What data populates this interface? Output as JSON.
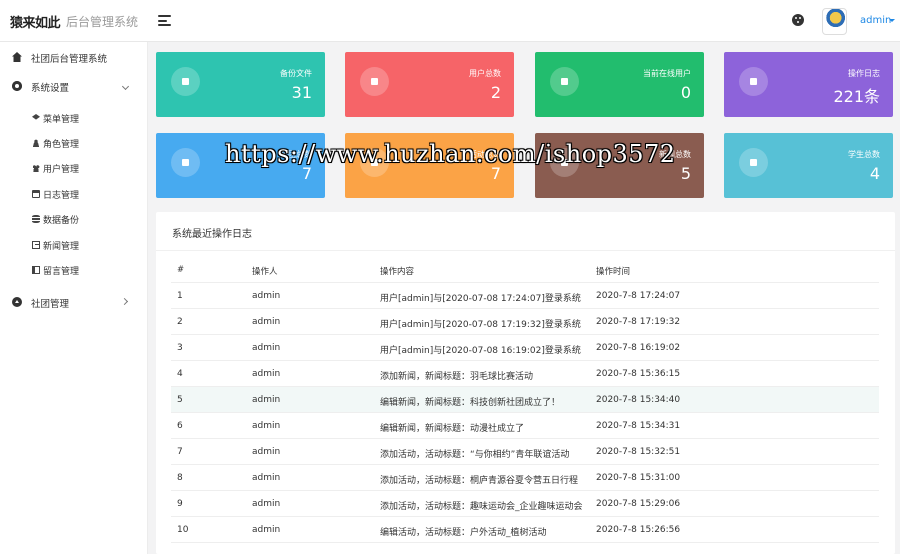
{
  "brand": {
    "logo": "猿来如此",
    "title": "后台管理系统"
  },
  "header": {
    "user": "admin"
  },
  "sidebar": {
    "items": [
      {
        "label": "社团后台管理系统"
      },
      {
        "label": "系统设置"
      },
      {
        "label": "菜单管理"
      },
      {
        "label": "角色管理"
      },
      {
        "label": "用户管理"
      },
      {
        "label": "日志管理"
      },
      {
        "label": "数据备份"
      },
      {
        "label": "新闻管理"
      },
      {
        "label": "留言管理"
      },
      {
        "label": "社团管理"
      }
    ]
  },
  "cards": [
    {
      "title": "备份文件",
      "value": "31",
      "color": "#2ec4b0"
    },
    {
      "title": "用户总数",
      "value": "2",
      "color": "#f66468"
    },
    {
      "title": "当前在线用户",
      "value": "0",
      "color": "#22bd6e"
    },
    {
      "title": "操作日志",
      "value": "221条",
      "color": "#8d63da"
    },
    {
      "title": "社团总数",
      "value": "7",
      "color": "#47aaf0"
    },
    {
      "title": "活动总数",
      "value": "7",
      "color": "#fba346"
    },
    {
      "title": "新闻总数",
      "value": "5",
      "color": "#8a5c50"
    },
    {
      "title": "学生总数",
      "value": "4",
      "color": "#57c1d6"
    }
  ],
  "watermark": "https://www.huzhan.com/ishop3572",
  "log_panel": {
    "title": "系统最近操作日志",
    "columns": [
      "#",
      "操作人",
      "操作内容",
      "操作时间"
    ],
    "rows": [
      [
        "1",
        "admin",
        "用户[admin]与[2020-07-08 17:24:07]登录系统",
        "2020-7-8 17:24:07"
      ],
      [
        "2",
        "admin",
        "用户[admin]与[2020-07-08 17:19:32]登录系统",
        "2020-7-8 17:19:32"
      ],
      [
        "3",
        "admin",
        "用户[admin]与[2020-07-08 16:19:02]登录系统",
        "2020-7-8 16:19:02"
      ],
      [
        "4",
        "admin",
        "添加新闻，新闻标题：羽毛球比赛活动",
        "2020-7-8 15:36:15"
      ],
      [
        "5",
        "admin",
        "编辑新闻，新闻标题：科技创新社团成立了！",
        "2020-7-8 15:34:40"
      ],
      [
        "6",
        "admin",
        "编辑新闻，新闻标题：动漫社成立了",
        "2020-7-8 15:34:31"
      ],
      [
        "7",
        "admin",
        "添加活动，活动标题：“与你相约”青年联谊活动",
        "2020-7-8 15:32:51"
      ],
      [
        "8",
        "admin",
        "添加活动，活动标题：桐庐青源谷夏令营五日行程",
        "2020-7-8 15:31:00"
      ],
      [
        "9",
        "admin",
        "添加活动，活动标题：趣味运动会_企业趣味运动会",
        "2020-7-8 15:29:06"
      ],
      [
        "10",
        "admin",
        "编辑活动，活动标题：户外活动_植树活动",
        "2020-7-8 15:26:56"
      ]
    ]
  }
}
